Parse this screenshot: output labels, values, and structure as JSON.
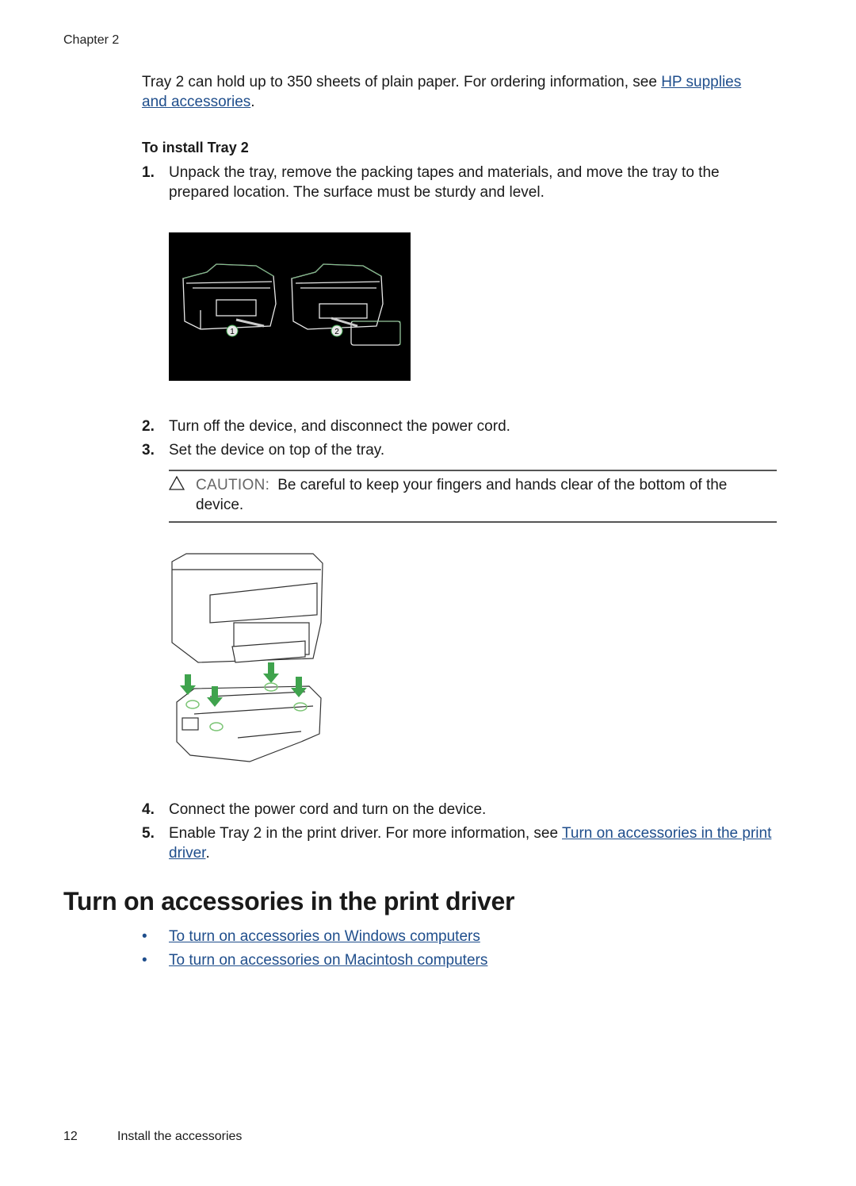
{
  "header": {
    "chapter": "Chapter 2"
  },
  "intro": {
    "text_before": "Tray 2 can hold up to 350 sheets of plain paper. For ordering information, see ",
    "link": "HP supplies and accessories",
    "text_after": "."
  },
  "procedure": {
    "title": "To install Tray 2",
    "steps": [
      {
        "num": "1.",
        "text": "Unpack the tray, remove the packing tapes and materials, and move the tray to the prepared location. The surface must be sturdy and level."
      },
      {
        "num": "2.",
        "text": "Turn off the device, and disconnect the power cord."
      },
      {
        "num": "3.",
        "text": "Set the device on top of the tray."
      },
      {
        "num": "4.",
        "text": "Connect the power cord and turn on the device."
      },
      {
        "num": "5.",
        "text_before": "Enable Tray 2 in the print driver. For more information, see ",
        "link": "Turn on accessories in the print driver",
        "text_after": "."
      }
    ],
    "caution": {
      "icon": "caution-triangle-icon",
      "label": "CAUTION:",
      "text": "Be careful to keep your fingers and hands clear of the bottom of the device."
    }
  },
  "figures": {
    "fig1": {
      "description": "Remove packing materials from tray (steps 1 and 2)",
      "callouts": [
        "1",
        "2"
      ]
    },
    "fig2": {
      "description": "Set the device on top of Tray 2"
    }
  },
  "section": {
    "title": "Turn on accessories in the print driver",
    "links": [
      "To turn on accessories on Windows computers",
      "To turn on accessories on Macintosh computers"
    ]
  },
  "footer": {
    "page_number": "12",
    "title": "Install the accessories"
  },
  "colors": {
    "link": "#1f4e8c",
    "figure_accent": "#3fa34d",
    "text": "#1a1a1a"
  }
}
